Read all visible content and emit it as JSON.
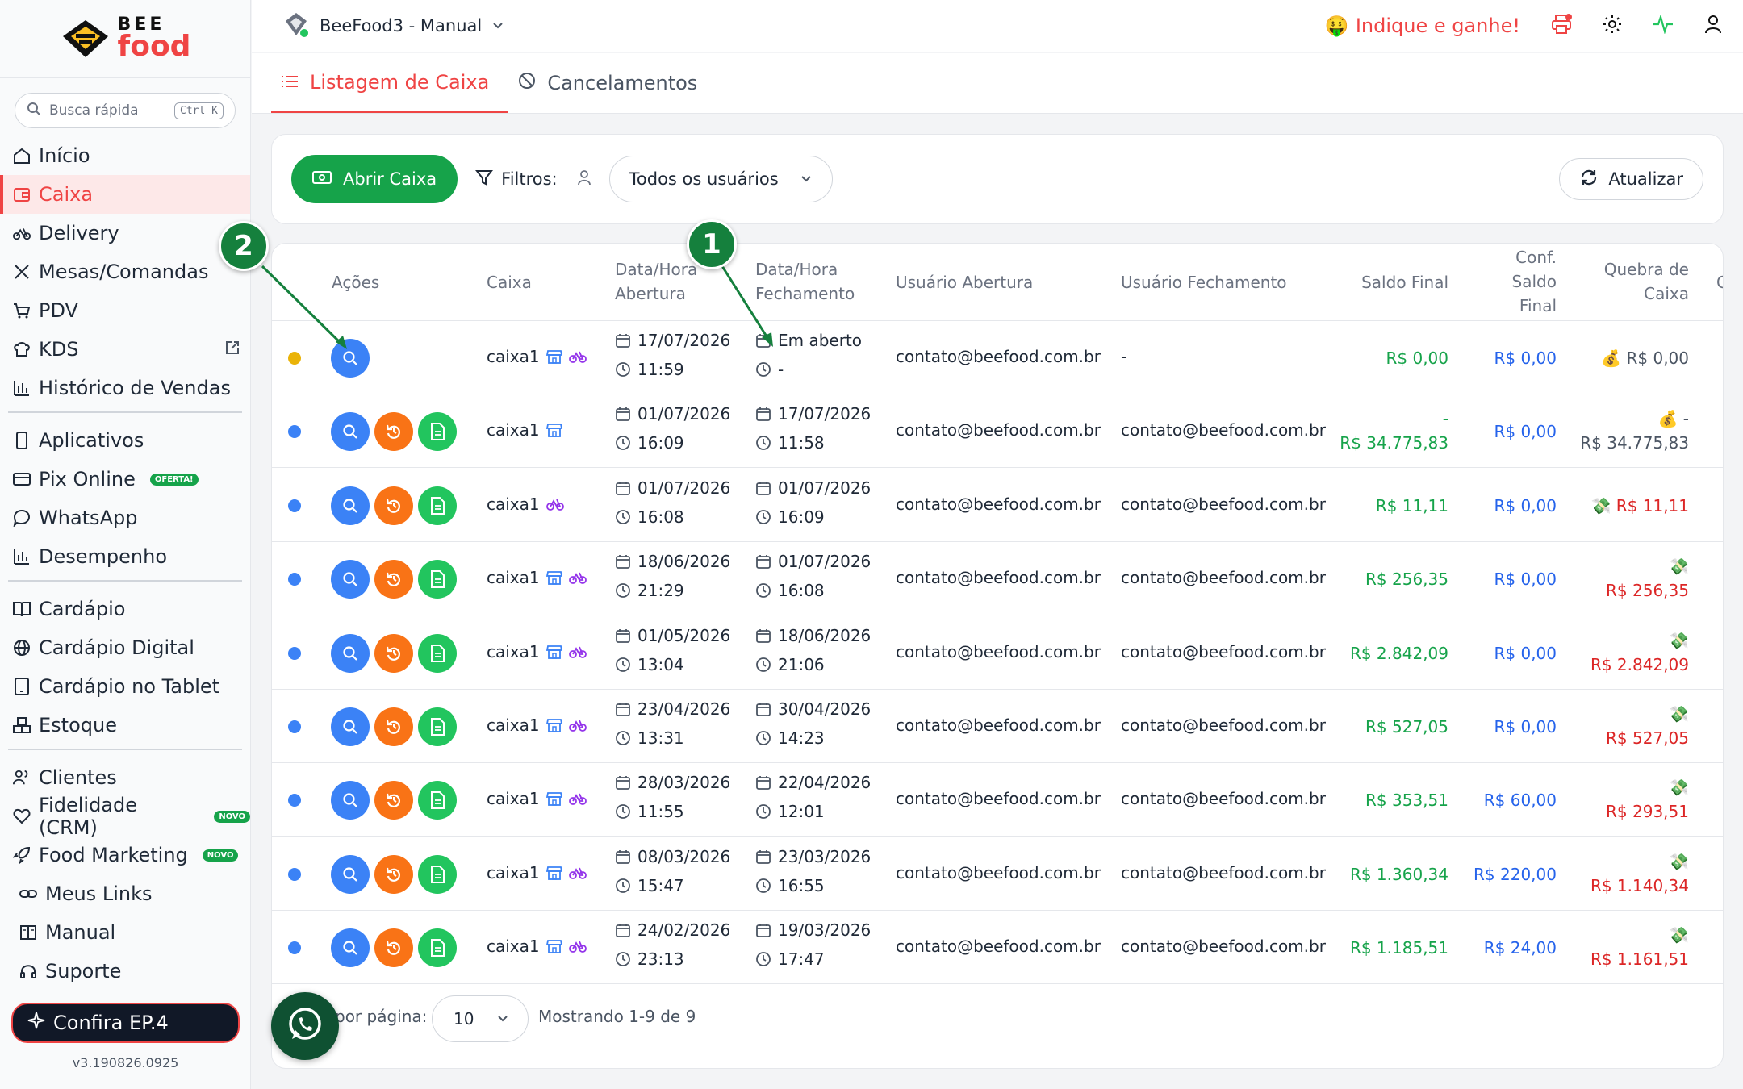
{
  "logo": {
    "top": "BEE",
    "bottom": "food"
  },
  "search": {
    "placeholder": "Busca rápida",
    "shortcut": "Ctrl K"
  },
  "sidebar": {
    "group1": [
      {
        "label": "Início",
        "icon": "home-icon"
      },
      {
        "label": "Caixa",
        "icon": "wallet-icon",
        "active": true
      },
      {
        "label": "Delivery",
        "icon": "bike-icon"
      },
      {
        "label": "Mesas/Comandas",
        "icon": "utensils-icon"
      },
      {
        "label": "PDV",
        "icon": "cart-icon"
      },
      {
        "label": "KDS",
        "icon": "chef-hat-icon"
      },
      {
        "label": "Histórico de Vendas",
        "icon": "bar-chart-icon"
      }
    ],
    "group2": [
      {
        "label": "Aplicativos",
        "icon": "phone-icon"
      },
      {
        "label": "Pix Online",
        "icon": "card-icon",
        "badge": "OFERTA!"
      },
      {
        "label": "WhatsApp",
        "icon": "chat-icon"
      },
      {
        "label": "Desempenho",
        "icon": "bar-chart-icon"
      }
    ],
    "group3": [
      {
        "label": "Cardápio",
        "icon": "book-icon"
      },
      {
        "label": "Cardápio Digital",
        "icon": "globe-icon"
      },
      {
        "label": "Cardápio no Tablet",
        "icon": "tablet-icon"
      },
      {
        "label": "Estoque",
        "icon": "boxes-icon"
      }
    ],
    "group4": [
      {
        "label": "Clientes",
        "icon": "users-icon"
      },
      {
        "label": "Fidelidade (CRM)",
        "icon": "heart-icon",
        "badge": "NOVO"
      },
      {
        "label": "Food Marketing",
        "icon": "rocket-icon",
        "badge": "NOVO"
      },
      {
        "label": "Meus Links",
        "icon": "link-icon"
      },
      {
        "label": "Manual",
        "icon": "book-open-icon"
      },
      {
        "label": "Suporte",
        "icon": "headset-icon"
      }
    ],
    "confira": "Confira EP.4",
    "version": "v3.190826.0925"
  },
  "header": {
    "store": "BeeFood3 - Manual",
    "indique": "Indique e ganhe!"
  },
  "tabs": [
    {
      "label": "Listagem de Caixa",
      "active": true
    },
    {
      "label": "Cancelamentos"
    }
  ],
  "toolbar": {
    "open_label": "Abrir Caixa",
    "filters_label": "Filtros:",
    "users_select": "Todos os usuários",
    "refresh_label": "Atualizar"
  },
  "table": {
    "headers": {
      "acoes": "Ações",
      "caixa": "Caixa",
      "abertura": [
        "Data/Hora",
        "Abertura"
      ],
      "fechamento": [
        "Data/Hora",
        "Fechamento"
      ],
      "usuario_abertura": "Usuário Abertura",
      "usuario_fechamento": "Usuário Fechamento",
      "saldo_final": "Saldo Final",
      "conf_saldo": [
        "Conf.",
        "Saldo",
        "Final"
      ],
      "quebra": [
        "Quebra de",
        "Caixa"
      ],
      "extra": "C"
    },
    "rows": [
      {
        "status": "#eab308",
        "caixa": "caixa1",
        "open_date": "17/07/2026",
        "open_time": "11:59",
        "close_date": "Em aberto",
        "close_time": "-",
        "user_open": "contato@beefood.com.br",
        "user_close": "-",
        "saldo": [
          "R$ 0,00"
        ],
        "conf": "R$ 0,00",
        "quebra_icon": "💰",
        "quebra": [
          "R$ 0,00"
        ],
        "quebra_color": "gray",
        "actions": 1,
        "delivery": true
      },
      {
        "status": "#3b82f6",
        "caixa": "caixa1",
        "open_date": "01/07/2026",
        "open_time": "16:09",
        "close_date": "17/07/2026",
        "close_time": "11:58",
        "user_open": "contato@beefood.com.br",
        "user_close": "contato@beefood.com.br",
        "saldo": [
          "-",
          "R$ 34.775,83"
        ],
        "conf": "R$ 0,00",
        "quebra_icon": "💰",
        "quebra": [
          "-",
          "R$ 34.775,83"
        ],
        "quebra_color": "gray",
        "actions": 3,
        "delivery": false
      },
      {
        "status": "#3b82f6",
        "caixa": "caixa1",
        "open_date": "01/07/2026",
        "open_time": "16:08",
        "close_date": "01/07/2026",
        "close_time": "16:09",
        "user_open": "contato@beefood.com.br",
        "user_close": "contato@beefood.com.br",
        "saldo": [
          "R$ 11,11"
        ],
        "conf": "R$ 0,00",
        "quebra_icon": "💸",
        "quebra": [
          "R$ 11,11"
        ],
        "quebra_color": "red",
        "actions": 3,
        "delivery": true,
        "no_store": true
      },
      {
        "status": "#3b82f6",
        "caixa": "caixa1",
        "open_date": "18/06/2026",
        "open_time": "21:29",
        "close_date": "01/07/2026",
        "close_time": "16:08",
        "user_open": "contato@beefood.com.br",
        "user_close": "contato@beefood.com.br",
        "saldo": [
          "R$ 256,35"
        ],
        "conf": "R$ 0,00",
        "quebra_icon": "💸",
        "quebra": [
          "",
          "R$ 256,35"
        ],
        "quebra_color": "red",
        "actions": 3,
        "delivery": true
      },
      {
        "status": "#3b82f6",
        "caixa": "caixa1",
        "open_date": "01/05/2026",
        "open_time": "13:04",
        "close_date": "18/06/2026",
        "close_time": "21:06",
        "user_open": "contato@beefood.com.br",
        "user_close": "contato@beefood.com.br",
        "saldo": [
          "R$ 2.842,09"
        ],
        "conf": "R$ 0,00",
        "quebra_icon": "💸",
        "quebra": [
          "",
          "R$ 2.842,09"
        ],
        "quebra_color": "red",
        "actions": 3,
        "delivery": true
      },
      {
        "status": "#3b82f6",
        "caixa": "caixa1",
        "open_date": "23/04/2026",
        "open_time": "13:31",
        "close_date": "30/04/2026",
        "close_time": "14:23",
        "user_open": "contato@beefood.com.br",
        "user_close": "contato@beefood.com.br",
        "saldo": [
          "R$ 527,05"
        ],
        "conf": "R$ 0,00",
        "quebra_icon": "💸",
        "quebra": [
          "",
          "R$ 527,05"
        ],
        "quebra_color": "red",
        "actions": 3,
        "delivery": true
      },
      {
        "status": "#3b82f6",
        "caixa": "caixa1",
        "open_date": "28/03/2026",
        "open_time": "11:55",
        "close_date": "22/04/2026",
        "close_time": "12:01",
        "user_open": "contato@beefood.com.br",
        "user_close": "contato@beefood.com.br",
        "saldo": [
          "R$ 353,51"
        ],
        "conf": "R$ 60,00",
        "quebra_icon": "💸",
        "quebra": [
          "",
          "R$ 293,51"
        ],
        "quebra_color": "red",
        "actions": 3,
        "delivery": true
      },
      {
        "status": "#3b82f6",
        "caixa": "caixa1",
        "open_date": "08/03/2026",
        "open_time": "15:47",
        "close_date": "23/03/2026",
        "close_time": "16:55",
        "user_open": "contato@beefood.com.br",
        "user_close": "contato@beefood.com.br",
        "saldo": [
          "R$ 1.360,34"
        ],
        "conf": "R$ 220,00",
        "quebra_icon": "💸",
        "quebra": [
          "",
          "R$ 1.140,34"
        ],
        "quebra_color": "red",
        "actions": 3,
        "delivery": true
      },
      {
        "status": "#3b82f6",
        "caixa": "caixa1",
        "open_date": "24/02/2026",
        "open_time": "23:13",
        "close_date": "19/03/2026",
        "close_time": "17:47",
        "user_open": "contato@beefood.com.br",
        "user_close": "contato@beefood.com.br",
        "saldo": [
          "R$ 1.185,51"
        ],
        "conf": "R$ 24,00",
        "quebra_icon": "💸",
        "quebra": [
          "",
          "R$ 1.161,51"
        ],
        "quebra_color": "red",
        "actions": 3,
        "delivery": true
      }
    ]
  },
  "pager": {
    "per_page_label": "por página:",
    "per_page": "10",
    "showing": "Mostrando 1-9 de 9"
  },
  "annotations": {
    "marker1": "1",
    "marker2": "2"
  },
  "colors": {
    "accent": "#ef4444",
    "primary_green": "#16a34a",
    "marker": "#15803d"
  }
}
